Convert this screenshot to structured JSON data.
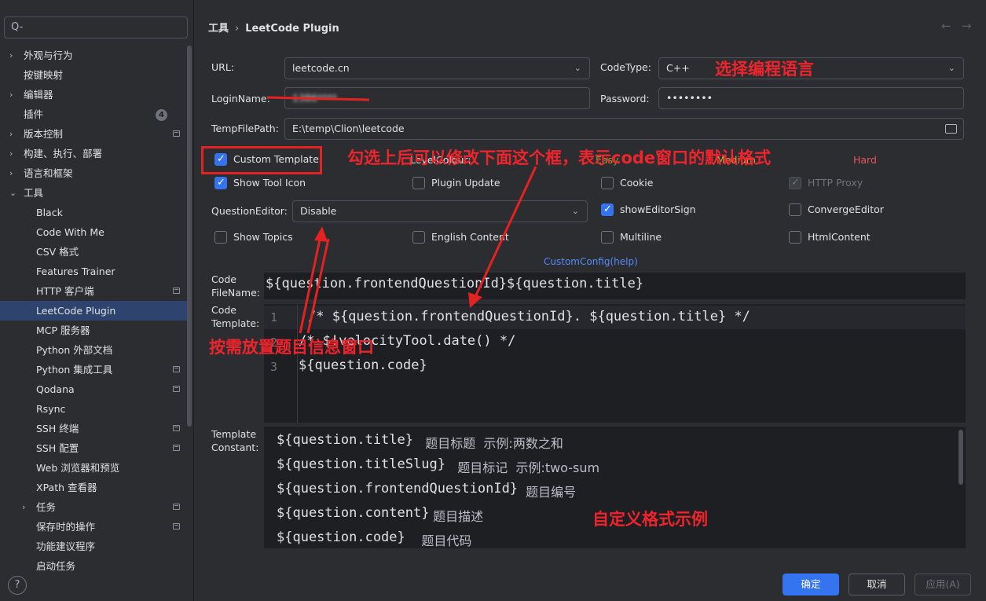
{
  "sidebar": {
    "search_placeholder": "Q-",
    "items": [
      {
        "label": "外观与行为",
        "chevron": "›"
      },
      {
        "label": "按键映射"
      },
      {
        "label": "编辑器",
        "chevron": "›"
      },
      {
        "label": "插件",
        "badge": "4"
      },
      {
        "label": "版本控制",
        "chevron": "›"
      },
      {
        "label": "构建、执行、部署",
        "chevron": "›"
      },
      {
        "label": "语言和框架",
        "chevron": "›"
      },
      {
        "label": "工具",
        "chevron": "⌄"
      },
      {
        "label": "Black"
      },
      {
        "label": "Code With Me"
      },
      {
        "label": "CSV 格式"
      },
      {
        "label": "Features Trainer"
      },
      {
        "label": "HTTP 客户端"
      },
      {
        "label": "LeetCode Plugin"
      },
      {
        "label": "MCP 服务器"
      },
      {
        "label": "Python 外部文档"
      },
      {
        "label": "Python 集成工具"
      },
      {
        "label": "Qodana"
      },
      {
        "label": "Rsync"
      },
      {
        "label": "SSH 终端"
      },
      {
        "label": "SSH 配置"
      },
      {
        "label": "Web 浏览器和预览"
      },
      {
        "label": "XPath 查看器"
      },
      {
        "label": "任务",
        "chevron": "›"
      },
      {
        "label": "保存时的操作"
      },
      {
        "label": "功能建议程序"
      },
      {
        "label": "启动任务"
      }
    ],
    "help": "?"
  },
  "header": {
    "crumb_parent": "工具",
    "crumb_sep": "›",
    "crumb_current": "LeetCode Plugin",
    "back": "←",
    "forward": "→"
  },
  "form": {
    "url_label": "URL:",
    "url_value": "leetcode.cn",
    "codetype_label": "CodeType:",
    "codetype_value": "C++",
    "login_label": "LoginName:",
    "login_value": "1386****",
    "password_label": "Password:",
    "password_value": "••••••••",
    "temppath_label": "TempFilePath:",
    "temppath_value": "E:\\temp\\Clion\\leetcode",
    "custom_template": "Custom Template",
    "level_colour": "LevelColour:",
    "easy": "Easy",
    "medium": "Medium",
    "hard": "Hard",
    "show_tool_icon": "Show Tool Icon",
    "plugin_update": "Plugin Update",
    "cookie": "Cookie",
    "http_proxy": "HTTP Proxy",
    "question_editor_label": "QuestionEditor:",
    "question_editor_value": "Disable",
    "show_editor_sign": "showEditorSign",
    "converge_editor": "ConvergeEditor",
    "show_topics": "Show Topics",
    "english_content": "English Content",
    "multiline": "Multiline",
    "html_content": "HtmlContent",
    "custom_config_link": "CustomConfig(help)",
    "code_filename_label_1": "Code",
    "code_filename_label_2": "FileName:",
    "code_filename_value": "${question.frontendQuestionId}${question.title}",
    "code_template_label_1": "Code",
    "code_template_label_2": "Template:",
    "template_lines": [
      {
        "no": "1",
        "text": "/* ${question.frontendQuestionId}. ${question.title} */"
      },
      {
        "no": "2",
        "text": "/* $!velocityTool.date() */"
      },
      {
        "no": "3",
        "text": "${question.code}"
      }
    ],
    "template_constant_label_1": "Template",
    "template_constant_label_2": "Constant:",
    "constants": [
      {
        "var": "${question.title}",
        "desc": "   题目标题  示例:两数之和"
      },
      {
        "var": "${question.titleSlug}",
        "desc": "   题目标记  示例:two-sum"
      },
      {
        "var": "${question.frontendQuestionId}",
        "desc": "  题目编号"
      },
      {
        "var": "${question.content}",
        "desc": " 题目描述"
      },
      {
        "var": "${question.code}",
        "desc": "    题目代码"
      }
    ]
  },
  "buttons": {
    "ok": "确定",
    "cancel": "取消",
    "apply": "应用(A)"
  },
  "annotations": {
    "lang": "选择编程语言",
    "check": "勾选上后可以修改下面这个框，表示code窗口的默认格式",
    "editor": "按需放置题目信息窗口",
    "example": "自定义格式示例"
  },
  "colors": {
    "accent": "#3574f0",
    "annotation": "#f0242c",
    "easy": "#5fb832",
    "medium": "#e6a23c",
    "hard": "#e9545a",
    "link": "#548af7"
  }
}
